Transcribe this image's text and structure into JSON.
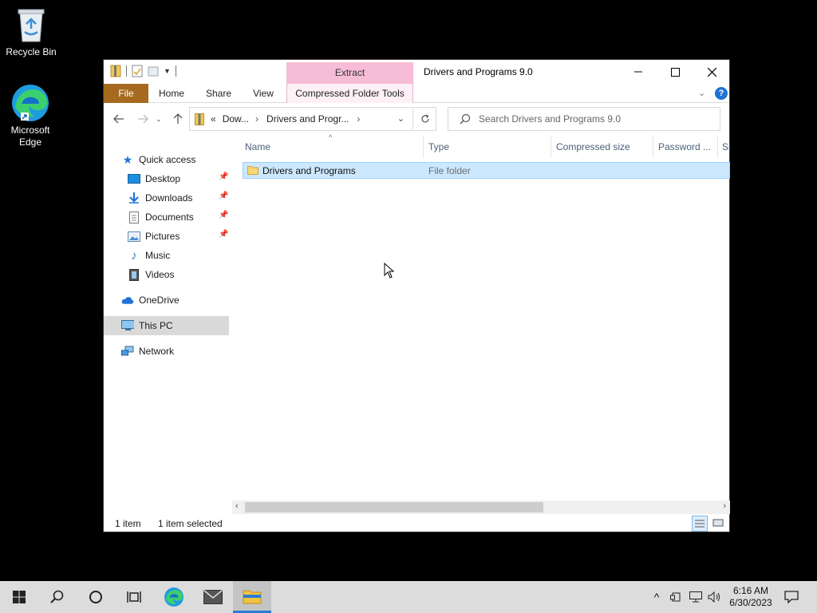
{
  "desktop": {
    "icons": [
      {
        "label": "Recycle Bin",
        "icon": "recycle-bin-icon"
      },
      {
        "label": "Microsoft Edge",
        "icon": "edge-icon"
      }
    ]
  },
  "window": {
    "title": "Drivers and Programs 9.0",
    "context_tab_group": "Extract",
    "ribbon_tabs": [
      "File",
      "Home",
      "Share",
      "View",
      "Compressed Folder Tools"
    ],
    "colors": {
      "file_tab": "#a66a1f",
      "context_tab": "#f7bcd6",
      "selection": "#cce8ff"
    }
  },
  "address_bar": {
    "overflow": "«",
    "crumbs": [
      "Dow...",
      "Drivers and Progr..."
    ]
  },
  "search": {
    "placeholder": "Search Drivers and Programs 9.0"
  },
  "nav_pane": {
    "quick_access": "Quick access",
    "pinned": [
      {
        "label": "Desktop",
        "icon": "desktop-folder-icon",
        "pinned": true
      },
      {
        "label": "Downloads",
        "icon": "downloads-folder-icon",
        "pinned": true
      },
      {
        "label": "Documents",
        "icon": "documents-folder-icon",
        "pinned": true
      },
      {
        "label": "Pictures",
        "icon": "pictures-folder-icon",
        "pinned": true
      },
      {
        "label": "Music",
        "icon": "music-folder-icon",
        "pinned": false
      },
      {
        "label": "Videos",
        "icon": "videos-folder-icon",
        "pinned": false
      }
    ],
    "onedrive": "OneDrive",
    "this_pc": "This PC",
    "network": "Network"
  },
  "file_list": {
    "columns": [
      "Name",
      "Type",
      "Compressed size",
      "Password ...",
      "Si"
    ],
    "rows": [
      {
        "name": "Drivers and Programs",
        "type": "File folder",
        "selected": true
      }
    ]
  },
  "status": {
    "count": "1 item",
    "selected": "1 item selected"
  },
  "taskbar": {
    "time": "6:16 AM",
    "date": "6/30/2023"
  }
}
